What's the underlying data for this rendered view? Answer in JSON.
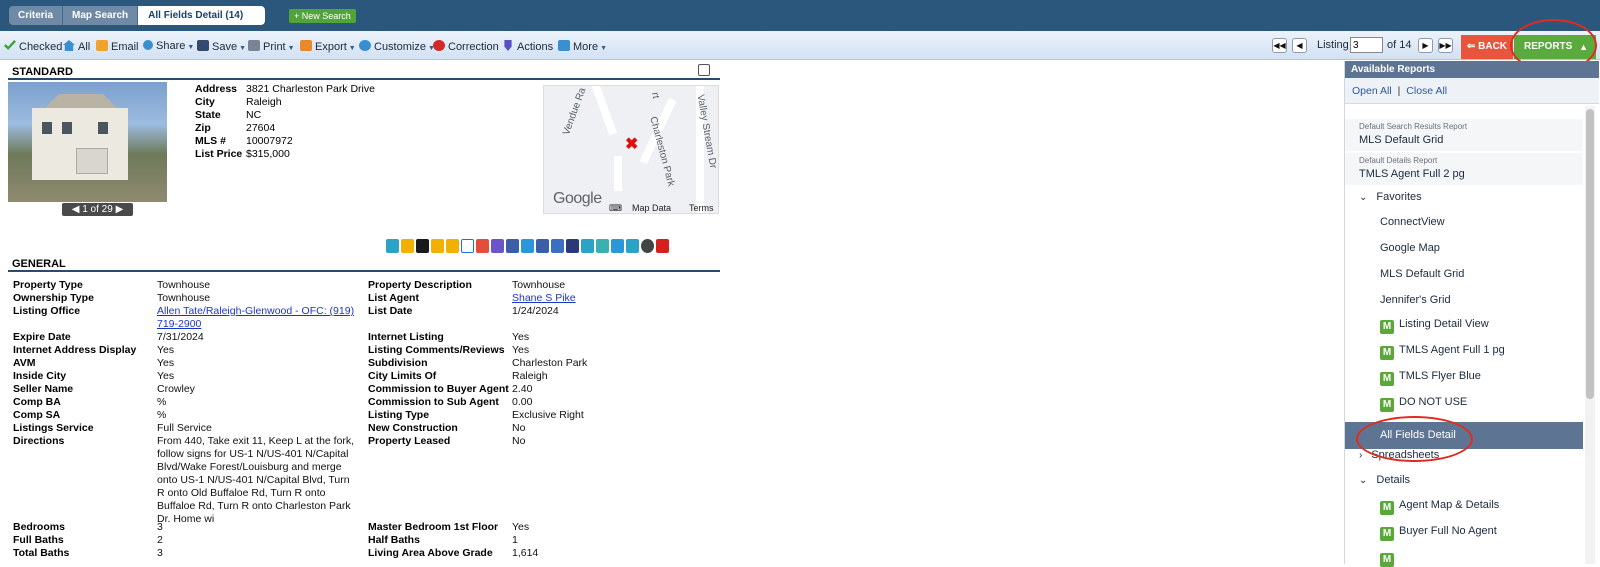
{
  "tabs": {
    "criteria": "Criteria",
    "map_search": "Map Search",
    "all_fields": "All Fields Detail (14)"
  },
  "new_search": "+ New Search",
  "toolbar": {
    "checked": "Checked",
    "all": "All",
    "email": "Email",
    "share": "Share",
    "save": "Save",
    "print": "Print",
    "export": "Export",
    "customize": "Customize",
    "correction": "Correction",
    "actions": "Actions",
    "more": "More"
  },
  "listing_nav": {
    "label": "Listing",
    "current": "3",
    "of": "of 14"
  },
  "back": "BACK",
  "reports": "REPORTS",
  "reports_arrow": "▲",
  "standard": {
    "header": "STANDARD",
    "address_lbl": "Address",
    "address": "3821 Charleston Park Drive",
    "city_lbl": "City",
    "city": "Raleigh",
    "state_lbl": "State",
    "state": "NC",
    "zip_lbl": "Zip",
    "zip": "27604",
    "mls_lbl": "MLS #",
    "mls": "10007972",
    "price_lbl": "List Price",
    "price": "$315,000",
    "photo_count": "1 of 29"
  },
  "map": {
    "road1": "Vendue Ra",
    "road2": "Charleston Park",
    "road3": "Valley Stream Dr",
    "road4": "rt",
    "logo": "Google",
    "map_data": "Map Data",
    "terms": "Terms"
  },
  "general": {
    "header": "GENERAL",
    "left": [
      {
        "label": "Property Type",
        "value": "Townhouse"
      },
      {
        "label": "Ownership Type",
        "value": "Townhouse"
      },
      {
        "label": "Listing Office",
        "value": "Allen Tate/Raleigh-Glenwood - OFC: (919) 719-2900"
      },
      {
        "label": "Expire Date",
        "value": "7/31/2024"
      },
      {
        "label": "Internet Address Display",
        "value": "Yes"
      },
      {
        "label": "AVM",
        "value": "Yes"
      },
      {
        "label": "Inside City",
        "value": "Yes"
      },
      {
        "label": "Seller Name",
        "value": "Crowley"
      },
      {
        "label": "Comp BA",
        "value": "%"
      },
      {
        "label": "Comp SA",
        "value": "%"
      },
      {
        "label": "Listings Service",
        "value": "Full Service"
      },
      {
        "label": "Directions",
        "value": "From 440, Take exit 11, Keep L at the fork, follow signs for US-1 N/US-401 N/Capital Blvd/Wake Forest/Louisburg and merge onto US-1 N/US-401 N/Capital Blvd, Turn R onto Old Buffaloe Rd, Turn R onto Buffaloe Rd, Turn R onto Charleston Park Dr. Home wi"
      },
      {
        "label": "Bedrooms",
        "value": "3"
      },
      {
        "label": "Full Baths",
        "value": "2"
      },
      {
        "label": "Total Baths",
        "value": "3"
      }
    ],
    "right": [
      {
        "label": "Property Description",
        "value": "Townhouse"
      },
      {
        "label": "List Agent",
        "value": "Shane S Pike"
      },
      {
        "label": "List Date",
        "value": "1/24/2024"
      },
      {
        "label": "Internet Listing",
        "value": "Yes"
      },
      {
        "label": "Listing Comments/Reviews",
        "value": "Yes"
      },
      {
        "label": "Subdivision",
        "value": "Charleston Park"
      },
      {
        "label": "City Limits Of",
        "value": "Raleigh"
      },
      {
        "label": "Commission to Buyer Agent",
        "value": "2.40"
      },
      {
        "label": "Commission to Sub Agent",
        "value": "0.00"
      },
      {
        "label": "Listing Type",
        "value": "Exclusive Right"
      },
      {
        "label": "New Construction",
        "value": "No"
      },
      {
        "label": "Property Leased",
        "value": "No"
      },
      {
        "label": "Master Bedroom 1st Floor",
        "value": "Yes"
      },
      {
        "label": "Half Baths",
        "value": "1"
      },
      {
        "label": "Living Area Above Grade",
        "value": "1,614"
      }
    ]
  },
  "reports_panel": {
    "header": "Available Reports",
    "open_all": "Open All",
    "sep": "|",
    "close_all": "Close All",
    "default_search_lbl": "Default Search Results Report",
    "default_search": "MLS Default Grid",
    "default_details_lbl": "Default Details Report",
    "default_details": "TMLS Agent Full 2 pg",
    "favorites": "Favorites",
    "fav_items": [
      "ConnectView",
      "Google Map",
      "MLS Default Grid",
      "Jennifer's Grid"
    ],
    "m_items": [
      "Listing Detail View",
      "TMLS Agent Full 1 pg",
      "TMLS Flyer Blue",
      "DO NOT USE"
    ],
    "selected": "All Fields Detail",
    "spreadsheets": "Spreadsheets",
    "details": "Details",
    "detail_items": [
      "Agent Map & Details",
      "Buyer Full No Agent"
    ],
    "m_badge": "M"
  }
}
